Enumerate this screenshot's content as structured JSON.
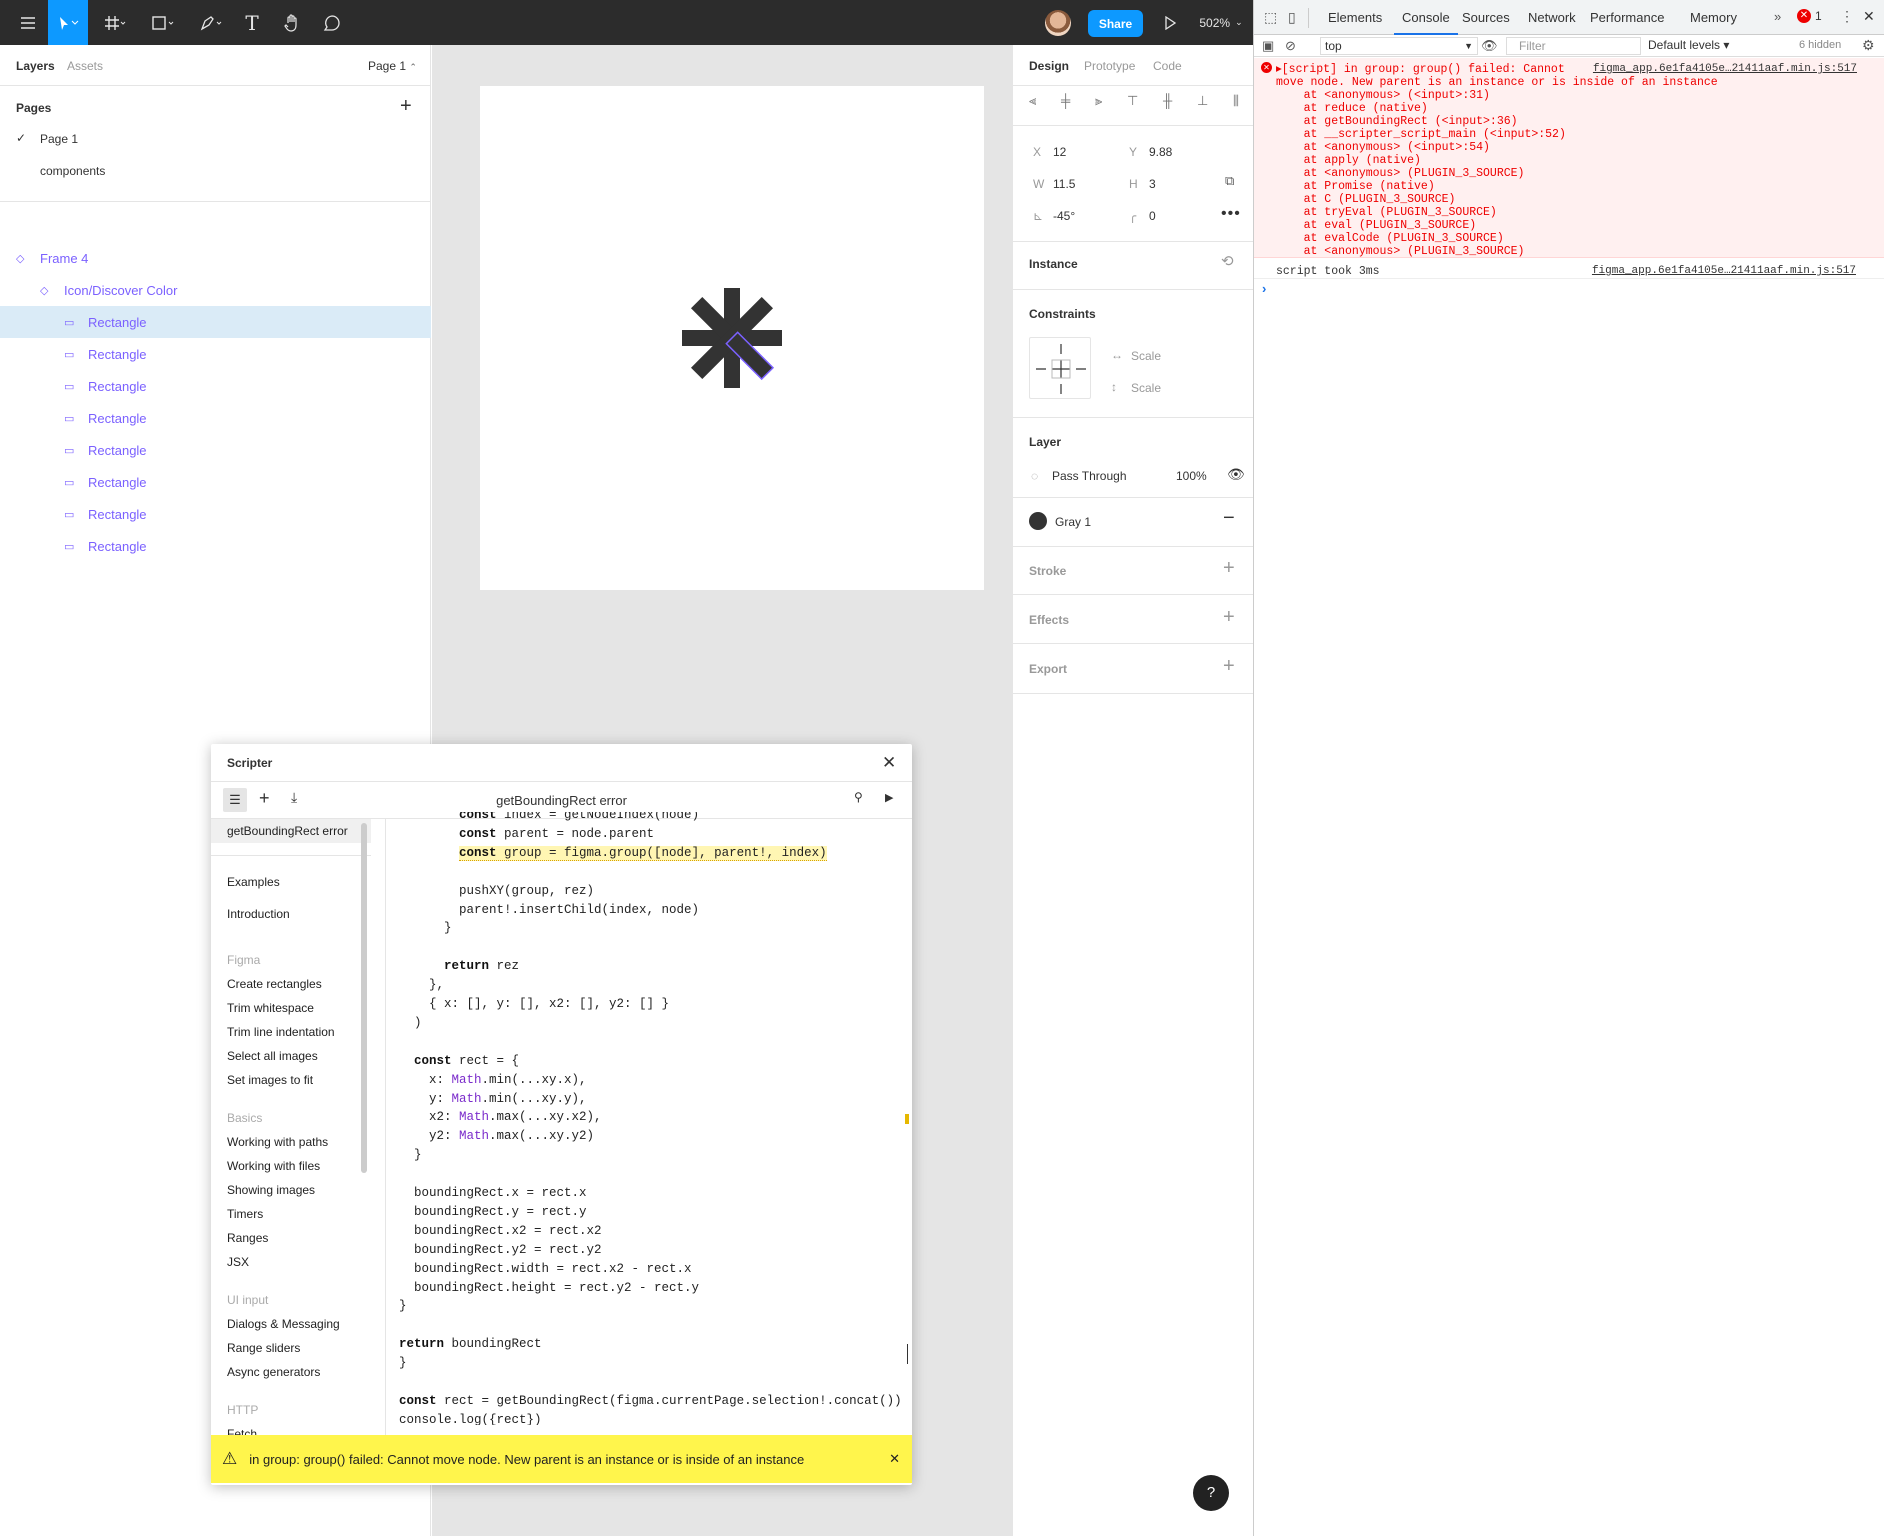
{
  "toolbar": {
    "share_label": "Share",
    "zoom": "502%",
    "icons": [
      "hamburger-icon",
      "move-icon",
      "frame-icon",
      "shape-icon",
      "pen-icon",
      "text-icon",
      "hand-icon",
      "comment-icon",
      "play-icon"
    ]
  },
  "left_panel": {
    "tabs": {
      "layers": "Layers",
      "assets": "Assets",
      "page_selector": "Page 1"
    },
    "pages_title": "Pages",
    "pages": [
      {
        "label": "Page 1",
        "selected": true
      },
      {
        "label": "components",
        "selected": false
      }
    ],
    "layers": [
      {
        "label": "Frame 4",
        "indent": 0
      },
      {
        "label": "Icon/Discover Color",
        "indent": 1
      },
      {
        "label": "Rectangle",
        "indent": 2,
        "selected": true
      },
      {
        "label": "Rectangle",
        "indent": 2
      },
      {
        "label": "Rectangle",
        "indent": 2
      },
      {
        "label": "Rectangle",
        "indent": 2
      },
      {
        "label": "Rectangle",
        "indent": 2
      },
      {
        "label": "Rectangle",
        "indent": 2
      },
      {
        "label": "Rectangle",
        "indent": 2
      },
      {
        "label": "Rectangle",
        "indent": 2
      }
    ]
  },
  "right_panel": {
    "tabs": {
      "design": "Design",
      "prototype": "Prototype",
      "code": "Code"
    },
    "x_label": "X",
    "x": "12",
    "y_label": "Y",
    "y": "9.88",
    "w_label": "W",
    "w": "11.5",
    "h_label": "H",
    "h": "3",
    "rotation_label": "⊾",
    "rotation": "-45°",
    "radius": "0",
    "instance_title": "Instance",
    "constraints_title": "Constraints",
    "constraint_h": "Scale",
    "constraint_v": "Scale",
    "layer_title": "Layer",
    "blend_mode": "Pass Through",
    "opacity": "100%",
    "fill_name": "Gray 1",
    "fill_color": "#333333",
    "stroke_title": "Stroke",
    "effects_title": "Effects",
    "export_title": "Export"
  },
  "scripter": {
    "title": "Scripter",
    "script_name": "getBoundingRect error",
    "current_script": "getBoundingRect error",
    "sections": [
      {
        "heading": "",
        "items": [
          "Examples",
          "Introduction"
        ]
      },
      {
        "heading": "Figma",
        "items": [
          "Create rectangles",
          "Trim whitespace",
          "Trim line indentation",
          "Select all images",
          "Set images to fit"
        ]
      },
      {
        "heading": "Basics",
        "items": [
          "Working with paths",
          "Working with files",
          "Showing images",
          "Timers",
          "Ranges",
          "JSX"
        ]
      },
      {
        "heading": "UI input",
        "items": [
          "Dialogs & Messaging",
          "Range sliders",
          "Async generators"
        ]
      },
      {
        "heading": "HTTP",
        "items": [
          "Fetch"
        ]
      }
    ],
    "code_lines": [
      "        const index = getNodeIndex(node)",
      "        const parent = node.parent",
      "        const group = figma.group([node], parent!, index)",
      "",
      "        pushXY(group, rez)",
      "        parent!.insertChild(index, node)",
      "      }",
      "",
      "      return rez",
      "    },",
      "    { x: [], y: [], x2: [], y2: [] }",
      "  )",
      "",
      "  const rect = {",
      "    x: Math.min(...xy.x),",
      "    y: Math.min(...xy.y),",
      "    x2: Math.max(...xy.x2),",
      "    y2: Math.max(...xy.y2)",
      "  }",
      "",
      "  boundingRect.x = rect.x",
      "  boundingRect.y = rect.y",
      "  boundingRect.x2 = rect.x2",
      "  boundingRect.y2 = rect.y2",
      "  boundingRect.width = rect.x2 - rect.x",
      "  boundingRect.height = rect.y2 - rect.y",
      "}",
      "",
      "return boundingRect",
      "}",
      "",
      "const rect = getBoundingRect(figma.currentPage.selection!.concat())",
      "console.log({rect})"
    ],
    "error_message": "in group: group() failed: Cannot move node. New parent is an instance or is inside of an instance"
  },
  "devtools": {
    "tabs": [
      "Elements",
      "Console",
      "Sources",
      "Network",
      "Performance",
      "Memory"
    ],
    "active_tab": "Console",
    "error_count": "1",
    "context": "top",
    "filter_placeholder": "Filter",
    "levels": "Default levels",
    "hidden": "6 hidden",
    "error_lines": [
      "▸[script] in group: group() failed: Cannot",
      "move node. New parent is an instance or is inside of an instance",
      "    at <anonymous> (<input>:31)",
      "    at reduce (native)",
      "    at getBoundingRect (<input>:36)",
      "    at __scripter_script_main (<input>:52)",
      "    at <anonymous> (<input>:54)",
      "    at apply (native)",
      "    at <anonymous> (PLUGIN_3_SOURCE)",
      "    at Promise (native)",
      "    at C (PLUGIN_3_SOURCE)",
      "    at tryEval (PLUGIN_3_SOURCE)",
      "    at eval (PLUGIN_3_SOURCE)",
      "    at evalCode (PLUGIN_3_SOURCE)",
      "    at <anonymous> (PLUGIN_3_SOURCE)"
    ],
    "source_link": "figma_app.6e1fa4105e…21411aaf.min.js:517",
    "log_line": "script took 3ms",
    "log_source": "figma_app.6e1fa4105e…21411aaf.min.js:517",
    "prompt": "›"
  }
}
